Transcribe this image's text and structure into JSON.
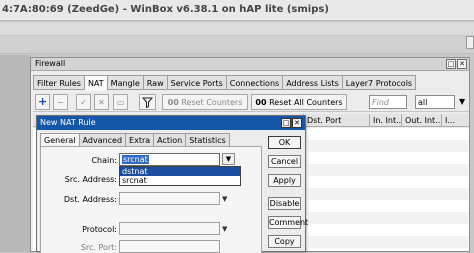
{
  "app": {
    "title": "4:7A:80:69 (ZeedGe) - WinBox v6.38.1 on hAP lite (smips)"
  },
  "firewall": {
    "title": "Firewall",
    "tabs": [
      {
        "label": "Filter Rules"
      },
      {
        "label": "NAT"
      },
      {
        "label": "Mangle"
      },
      {
        "label": "Raw"
      },
      {
        "label": "Service Ports"
      },
      {
        "label": "Connections"
      },
      {
        "label": "Address Lists"
      },
      {
        "label": "Layer7 Protocols"
      }
    ],
    "toolbar": {
      "add": "+",
      "remove": "−",
      "enable": "✓",
      "disable": "✕",
      "comment": "▭",
      "reset_counters": "Reset Counters",
      "reset_all_counters": "Reset All Counters",
      "counters_glyph": "00",
      "find_placeholder": "Find",
      "filter_value": "all"
    },
    "columns": [
      "Dst. Port",
      "In. Int...",
      "Out. Int...",
      "I..."
    ]
  },
  "nat_dialog": {
    "title": "New NAT Rule",
    "tabs": [
      {
        "label": "General"
      },
      {
        "label": "Advanced"
      },
      {
        "label": "Extra"
      },
      {
        "label": "Action"
      },
      {
        "label": "Statistics"
      }
    ],
    "fields": {
      "chain_label": "Chain:",
      "chain_value": "srcnat",
      "src_address_label": "Src. Address:",
      "dst_address_label": "Dst. Address:",
      "protocol_label": "Protocol:",
      "src_port_label": "Src. Port:"
    },
    "chain_options": [
      "dstnat",
      "srcnat"
    ],
    "buttons": {
      "ok": "OK",
      "cancel": "Cancel",
      "apply": "Apply",
      "disable": "Disable",
      "comment": "Comment",
      "copy": "Copy"
    }
  }
}
